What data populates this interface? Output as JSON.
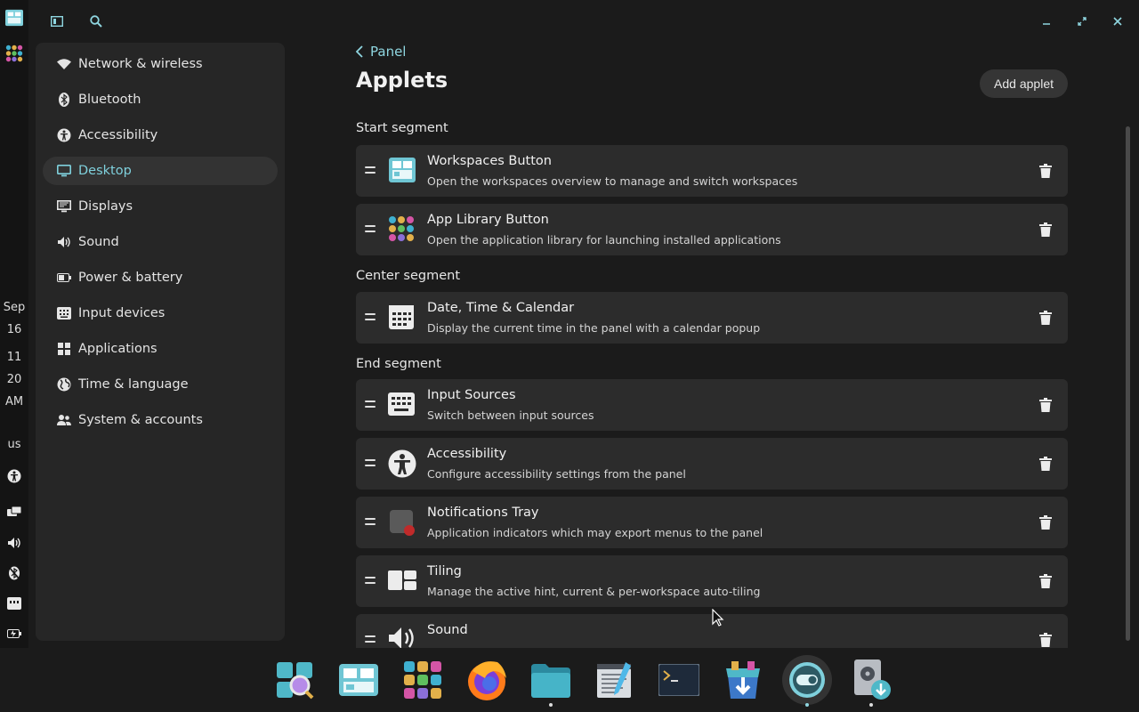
{
  "vpanel": {
    "clock": [
      "Sep",
      "16",
      "11",
      "20",
      "AM"
    ],
    "input_source": "us"
  },
  "sidebar": {
    "items": [
      {
        "label": "Network & wireless",
        "icon": "wifi-icon"
      },
      {
        "label": "Bluetooth",
        "icon": "bluetooth-icon"
      },
      {
        "label": "Accessibility",
        "icon": "accessibility-icon"
      },
      {
        "label": "Desktop",
        "icon": "desktop-icon",
        "active": true
      },
      {
        "label": "Displays",
        "icon": "display-icon"
      },
      {
        "label": "Sound",
        "icon": "speaker-icon"
      },
      {
        "label": "Power & battery",
        "icon": "battery-icon"
      },
      {
        "label": "Input devices",
        "icon": "keyboard-icon"
      },
      {
        "label": "Applications",
        "icon": "grid-icon"
      },
      {
        "label": "Time & language",
        "icon": "globe-icon"
      },
      {
        "label": "System & accounts",
        "icon": "users-icon"
      }
    ]
  },
  "main": {
    "back_label": "Panel",
    "title": "Applets",
    "add_button": "Add applet",
    "segments": {
      "start": "Start segment",
      "center": "Center segment",
      "end": "End segment"
    },
    "applets": [
      {
        "name": "Workspaces Button",
        "desc": "Open the workspaces overview to manage and switch workspaces"
      },
      {
        "name": "App Library Button",
        "desc": "Open the application library for launching installed applications"
      },
      {
        "name": "Date, Time & Calendar",
        "desc": "Display the current time in the panel with a calendar popup"
      },
      {
        "name": "Input Sources",
        "desc": "Switch between input sources"
      },
      {
        "name": "Accessibility",
        "desc": "Configure accessibility settings from the panel"
      },
      {
        "name": "Notifications Tray",
        "desc": "Application indicators which may export menus to the panel"
      },
      {
        "name": "Tiling",
        "desc": "Manage the active hint, current & per-workspace auto-tiling"
      },
      {
        "name": "Sound",
        "desc": ""
      }
    ]
  },
  "colors": {
    "accent": "#8fd6e0",
    "background": "#1b1b1b",
    "card": "#2c2c2c",
    "sidebar": "#262626"
  }
}
